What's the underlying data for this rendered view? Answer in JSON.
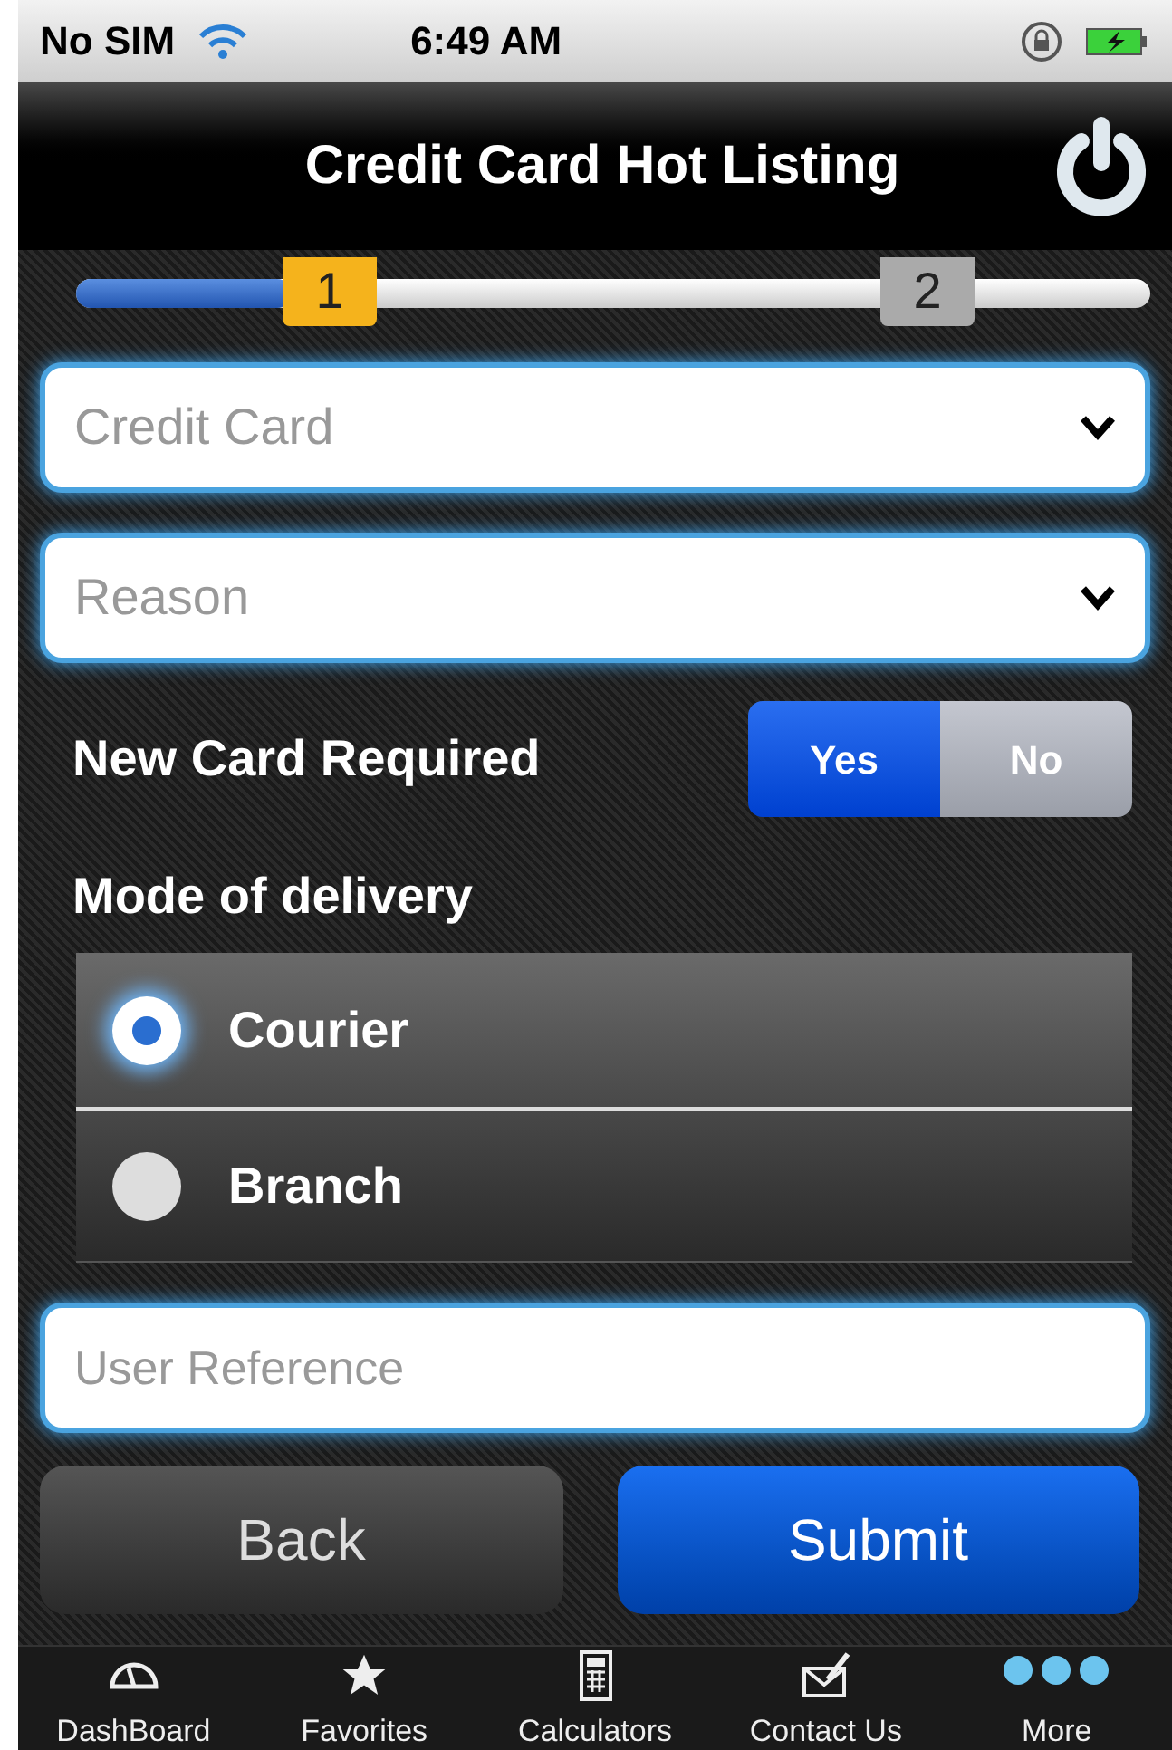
{
  "status_bar": {
    "carrier": "No SIM",
    "time": "6:49 AM"
  },
  "nav_bar": {
    "title": "Credit Card Hot Listing"
  },
  "progress": {
    "level": 0.2,
    "steps": [
      {
        "label": "1",
        "selected": true
      },
      {
        "label": "2",
        "selected": false
      }
    ]
  },
  "selects": [
    {
      "placeholder": "Credit Card"
    },
    {
      "placeholder": "Reason"
    }
  ],
  "new_card": {
    "label": "New Card Required",
    "options": [
      {
        "label": "Yes",
        "selected": true
      },
      {
        "label": "No",
        "selected": false
      }
    ]
  },
  "delivery": {
    "label": "Mode of delivery",
    "options": [
      {
        "label": "Courier",
        "selected": true
      },
      {
        "label": "Branch",
        "selected": false
      }
    ]
  },
  "reference": {
    "placeholder": "User Reference"
  },
  "buttons": [
    {
      "label": "Back",
      "kind": "secondary"
    },
    {
      "label": "Submit",
      "kind": "primary"
    }
  ],
  "tab_bar": [
    {
      "label": "DashBoard"
    },
    {
      "label": "Favorites"
    },
    {
      "label": "Calculators"
    },
    {
      "label": "Contact Us"
    },
    {
      "label": "More"
    }
  ]
}
